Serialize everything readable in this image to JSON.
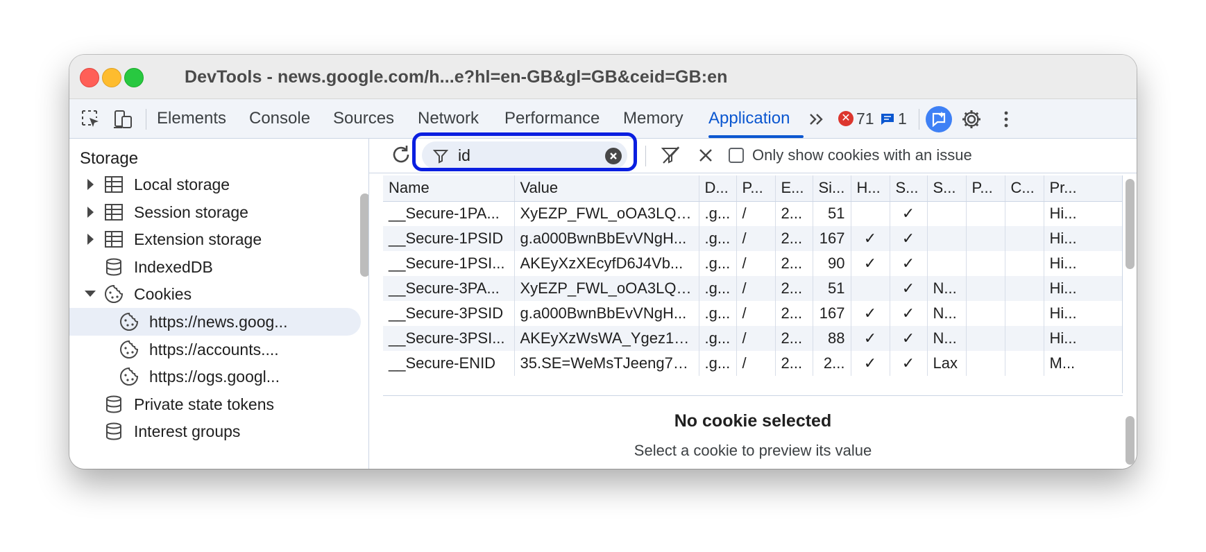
{
  "window": {
    "title": "DevTools - news.google.com/h...e?hl=en-GB&gl=GB&ceid=GB:en"
  },
  "toolbar": {
    "tabs": [
      "Elements",
      "Console",
      "Sources",
      "Network",
      "Performance",
      "Memory",
      "Application"
    ],
    "active_tab": "Application",
    "more_tabs": "»",
    "error_count": "71",
    "message_count": "1",
    "error_symbol": "✕"
  },
  "sidebar": {
    "heading": "Storage",
    "items": [
      {
        "label": "Local storage",
        "icon": "table-icon",
        "expander": "collapsed"
      },
      {
        "label": "Session storage",
        "icon": "table-icon",
        "expander": "collapsed"
      },
      {
        "label": "Extension storage",
        "icon": "table-icon",
        "expander": "collapsed"
      },
      {
        "label": "IndexedDB",
        "icon": "database-icon",
        "expander": "none"
      },
      {
        "label": "Cookies",
        "icon": "cookie-icon",
        "expander": "expanded"
      },
      {
        "label": "https://news.goog...",
        "icon": "cookie-icon",
        "selected": true
      },
      {
        "label": "https://accounts....",
        "icon": "cookie-icon"
      },
      {
        "label": "https://ogs.googl...",
        "icon": "cookie-icon"
      },
      {
        "label": "Private state tokens",
        "icon": "database-icon"
      },
      {
        "label": "Interest groups",
        "icon": "database-icon"
      }
    ]
  },
  "filter": {
    "value": "id",
    "only_issue_label": "Only show cookies with an issue",
    "only_issue_checked": false
  },
  "table": {
    "columns": [
      "Name",
      "Value",
      "D...",
      "P...",
      "E...",
      "Si...",
      "H...",
      "S...",
      "S...",
      "P...",
      "C...",
      "Pr..."
    ],
    "rows": [
      [
        "__Secure-1PA...",
        "XyEZP_FWL_oOA3LQ/...",
        ".g...",
        "/",
        "2...",
        "51",
        "",
        "✓",
        "",
        "",
        "",
        "Hi..."
      ],
      [
        "__Secure-1PSID",
        "g.a000BwnBbEvVNgH...",
        ".g...",
        "/",
        "2...",
        "167",
        "✓",
        "✓",
        "",
        "",
        "",
        "Hi..."
      ],
      [
        "__Secure-1PSI...",
        "AKEyXzXEcyfD6J4Vb...",
        ".g...",
        "/",
        "2...",
        "90",
        "✓",
        "✓",
        "",
        "",
        "",
        "Hi..."
      ],
      [
        "__Secure-3PA...",
        "XyEZP_FWL_oOA3LQ/...",
        ".g...",
        "/",
        "2...",
        "51",
        "",
        "✓",
        "N...",
        "",
        "",
        "Hi..."
      ],
      [
        "__Secure-3PSID",
        "g.a000BwnBbEvVNgH...",
        ".g...",
        "/",
        "2...",
        "167",
        "✓",
        "✓",
        "N...",
        "",
        "",
        "Hi..."
      ],
      [
        "__Secure-3PSI...",
        "AKEyXzWsWA_Ygez16...",
        ".g...",
        "/",
        "2...",
        "88",
        "✓",
        "✓",
        "N...",
        "",
        "",
        "Hi..."
      ],
      [
        "__Secure-ENID",
        "35.SE=WeMsTJeeng7u...",
        ".g...",
        "/",
        "2...",
        "2...",
        "✓",
        "✓",
        "Lax",
        "",
        "",
        "M..."
      ]
    ]
  },
  "preview": {
    "title": "No cookie selected",
    "subtitle": "Select a cookie to preview its value"
  },
  "colors": {
    "accent": "#0b57d0",
    "highlight_border": "#0a1fe0",
    "error": "#dc362e",
    "selected_bg": "#e9eef7"
  }
}
